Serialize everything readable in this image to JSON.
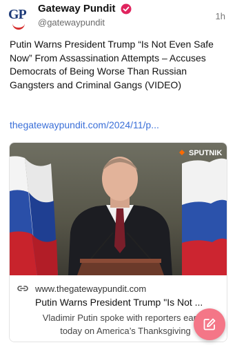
{
  "author": {
    "name": "Gateway Pundit",
    "handle": "@gatewaypundit",
    "avatar_text": "GP",
    "verified_icon": "verified-badge-icon",
    "verified_color": "#e0245e"
  },
  "time": "1h",
  "post": {
    "text": "Putin Warns President Trump “Is Not Even Safe Now” From Assassination Attempts – Accuses Democrats of Being Worse Than Russian Gangsters and Criminal Gangs (VIDEO)",
    "link": "thegatewaypundit.com/2024/11/p..."
  },
  "card": {
    "image_watermark": "SPUTNIK",
    "domain_icon": "link-icon",
    "domain": "www.thegatewaypundit.com",
    "title": "Putin Warns President Trump \"Is Not ...",
    "description": "Vladimir Putin spoke with reporters earlier today on America’s Thanksgiving"
  },
  "compose": {
    "icon": "edit-icon",
    "color": "#f47687"
  },
  "colors": {
    "link": "#3a6fd8",
    "accent": "#f47687"
  }
}
